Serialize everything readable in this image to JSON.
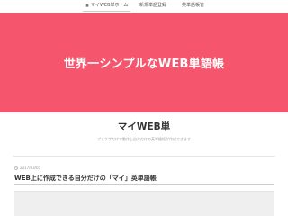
{
  "nav": {
    "items": [
      {
        "label": "マイWEB単ホーム",
        "icon": "home-icon",
        "active": true
      },
      {
        "label": "新規単語登録",
        "active": false
      },
      {
        "label": "英単語帳管",
        "active": false
      }
    ]
  },
  "hero": {
    "title": "世界一シンプルなWEB単語帳",
    "background": "#f6566d"
  },
  "site": {
    "title": "マイWEB単",
    "description": "ブラウザだけで動作し自分だけの英単語帳が作成できます"
  },
  "post": {
    "date": "2017/03/05",
    "date_icon": "clock-icon",
    "title": "WEB上に作成できる自分だけの「マイ」英単語帳"
  }
}
